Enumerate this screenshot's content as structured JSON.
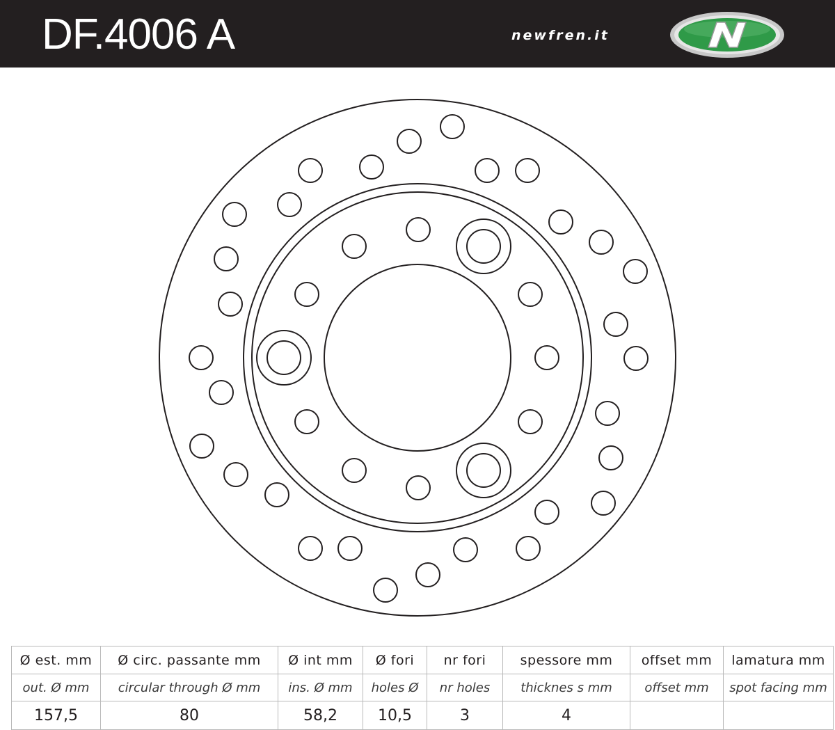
{
  "header": {
    "title": "DF.4006 A",
    "website": "newfren.it",
    "background": "#231f20",
    "logo_colors": {
      "ring": "#c8c8c8",
      "fill": "#2f9a48",
      "mark": "#ffffff"
    }
  },
  "specs": {
    "columns": [
      {
        "it": "Ø est. mm",
        "en": "out. Ø mm",
        "value": "157,5"
      },
      {
        "it": "Ø circ. passante mm",
        "en": "circular through Ø mm",
        "value": "80"
      },
      {
        "it": "Ø int mm",
        "en": "ins. Ø mm",
        "value": "58,2"
      },
      {
        "it": "Ø fori",
        "en": "holes Ø",
        "value": "10,5"
      },
      {
        "it": "nr fori",
        "en": "nr holes",
        "value": "3"
      },
      {
        "it": "spessore mm",
        "en": "thicknes s mm",
        "value": "4"
      },
      {
        "it": "offset mm",
        "en": "offset mm",
        "value": ""
      },
      {
        "it": "lamatura mm",
        "en": "spot facing mm",
        "value": ""
      }
    ]
  },
  "colors": {
    "line": "#231f20",
    "grid": "#b9b9b9"
  }
}
